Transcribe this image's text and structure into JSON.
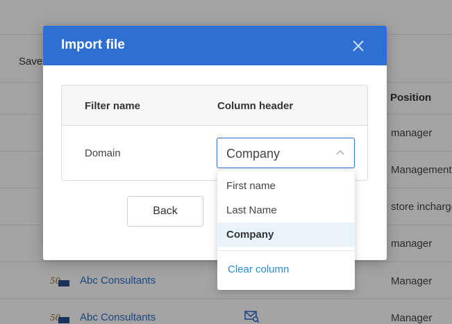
{
  "background": {
    "save_label": "Save",
    "position_header": "Position",
    "positions": [
      "manager",
      "Management",
      "store incharge",
      "manager",
      "Manager",
      "Manager"
    ],
    "companies": [
      "Abc Consultants",
      "Abc Consultants"
    ],
    "mail_icon": "mail-search-icon"
  },
  "modal": {
    "title": "Import file",
    "close_icon": "close-icon",
    "table": {
      "headers": [
        "Filter name",
        "Column header"
      ],
      "row": {
        "filter_name": "Domain",
        "selected_column": "Company"
      }
    },
    "back_label": "Back"
  },
  "dropdown": {
    "options": [
      "First name",
      "Last Name",
      "Company"
    ],
    "selected": "Company",
    "clear_label": "Clear column"
  },
  "colors": {
    "header_blue": "#2f6fd1",
    "link_blue": "#2a8ad9",
    "selected_bg": "#e8f3fb"
  }
}
